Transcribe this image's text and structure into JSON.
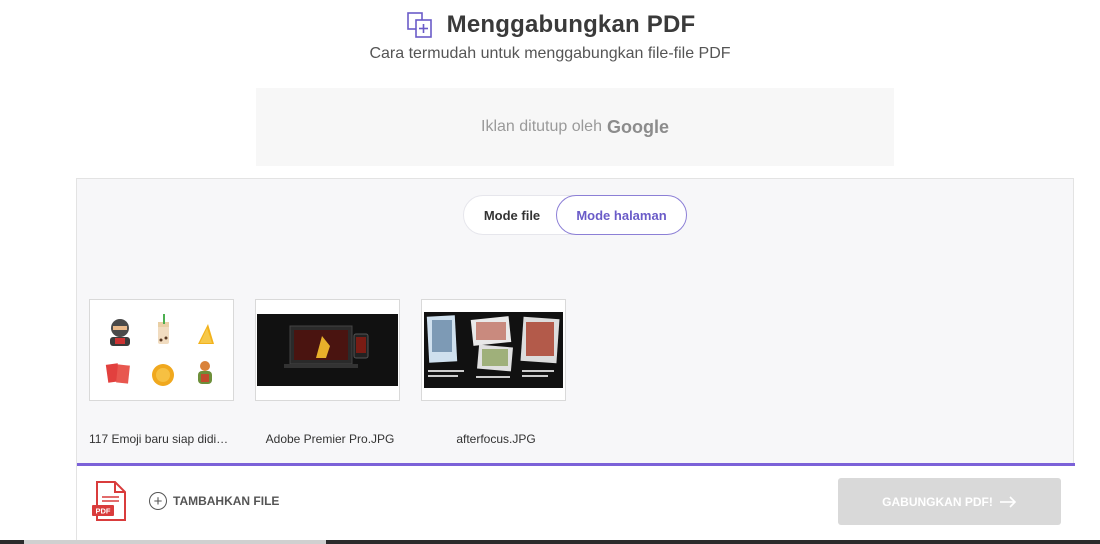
{
  "header": {
    "title": "Menggabungkan PDF",
    "subtitle": "Cara termudah untuk menggabungkan file-file PDF",
    "icon": "merge-pages-icon"
  },
  "ad": {
    "text": "Iklan ditutup oleh",
    "brand": "Google"
  },
  "mode_toggle": {
    "file_mode": "Mode file",
    "page_mode": "Mode halaman",
    "selected": "Mode halaman"
  },
  "files": [
    {
      "name": "117 Emoji baru siap didi…",
      "thumbnail": "emoji-grid"
    },
    {
      "name": "Adobe Premier Pro.JPG",
      "thumbnail": "video-editor-screenshot"
    },
    {
      "name": "afterfocus.JPG",
      "thumbnail": "photo-collage"
    }
  ],
  "bottombar": {
    "add_file": "TAMBAHKAN FILE",
    "merge_button": "GABUNGKAN PDF!",
    "merge_enabled": false
  },
  "colors": {
    "accent": "#7b61d8",
    "pdf_red": "#d93c3c",
    "button_disabled": "#d9d9d9"
  }
}
